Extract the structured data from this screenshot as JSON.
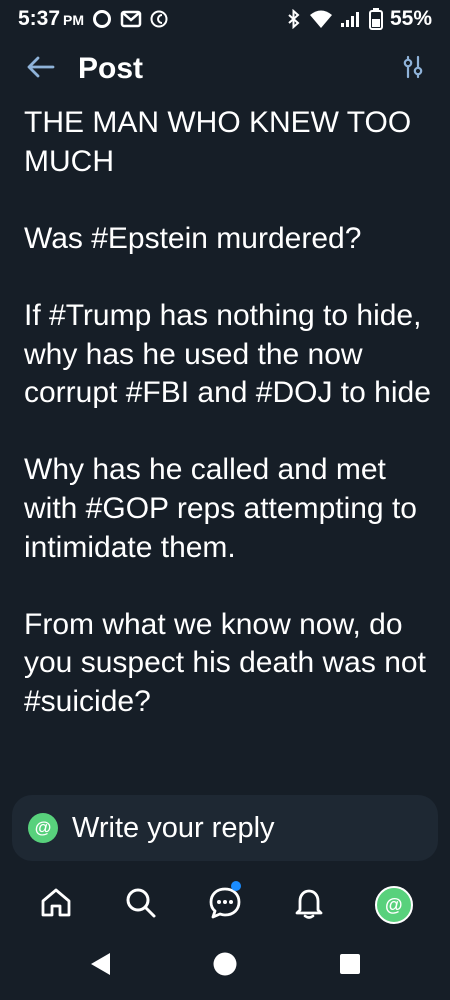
{
  "status_bar": {
    "time": "5:37",
    "ampm": "PM",
    "battery": "55%",
    "left_icons": [
      "circle-notification-icon",
      "gmail-icon",
      "currency-app-icon"
    ],
    "right_icons": [
      "bluetooth-icon",
      "wifi-icon",
      "signal-icon",
      "battery-icon"
    ]
  },
  "header": {
    "title": "Post",
    "back_icon": "arrow-left-icon",
    "filter_icon": "sliders-icon"
  },
  "post": {
    "paragraphs": [
      "THE MAN WHO KNEW TOO MUCH",
      "Was #Epstein murdered?",
      "If #Trump has nothing to hide, why has he used the now corrupt #FBI and #DOJ to hide",
      "Why has he called and met with #GOP reps attempting to intimidate them.",
      "From what we know now, do you suspect his death was not #suicide?"
    ]
  },
  "reply": {
    "avatar_glyph": "@",
    "placeholder": "Write your reply"
  },
  "bottom_nav": {
    "items": [
      "home-icon",
      "search-icon",
      "chat-icon",
      "bell-icon",
      "profile-avatar"
    ],
    "avatar_glyph": "@"
  },
  "colors": {
    "background": "#161e27",
    "reply_bg": "#1e2833",
    "accent_green": "#58d17c",
    "accent_blue": "#1a8cff",
    "header_icon": "#8fb3d9"
  }
}
